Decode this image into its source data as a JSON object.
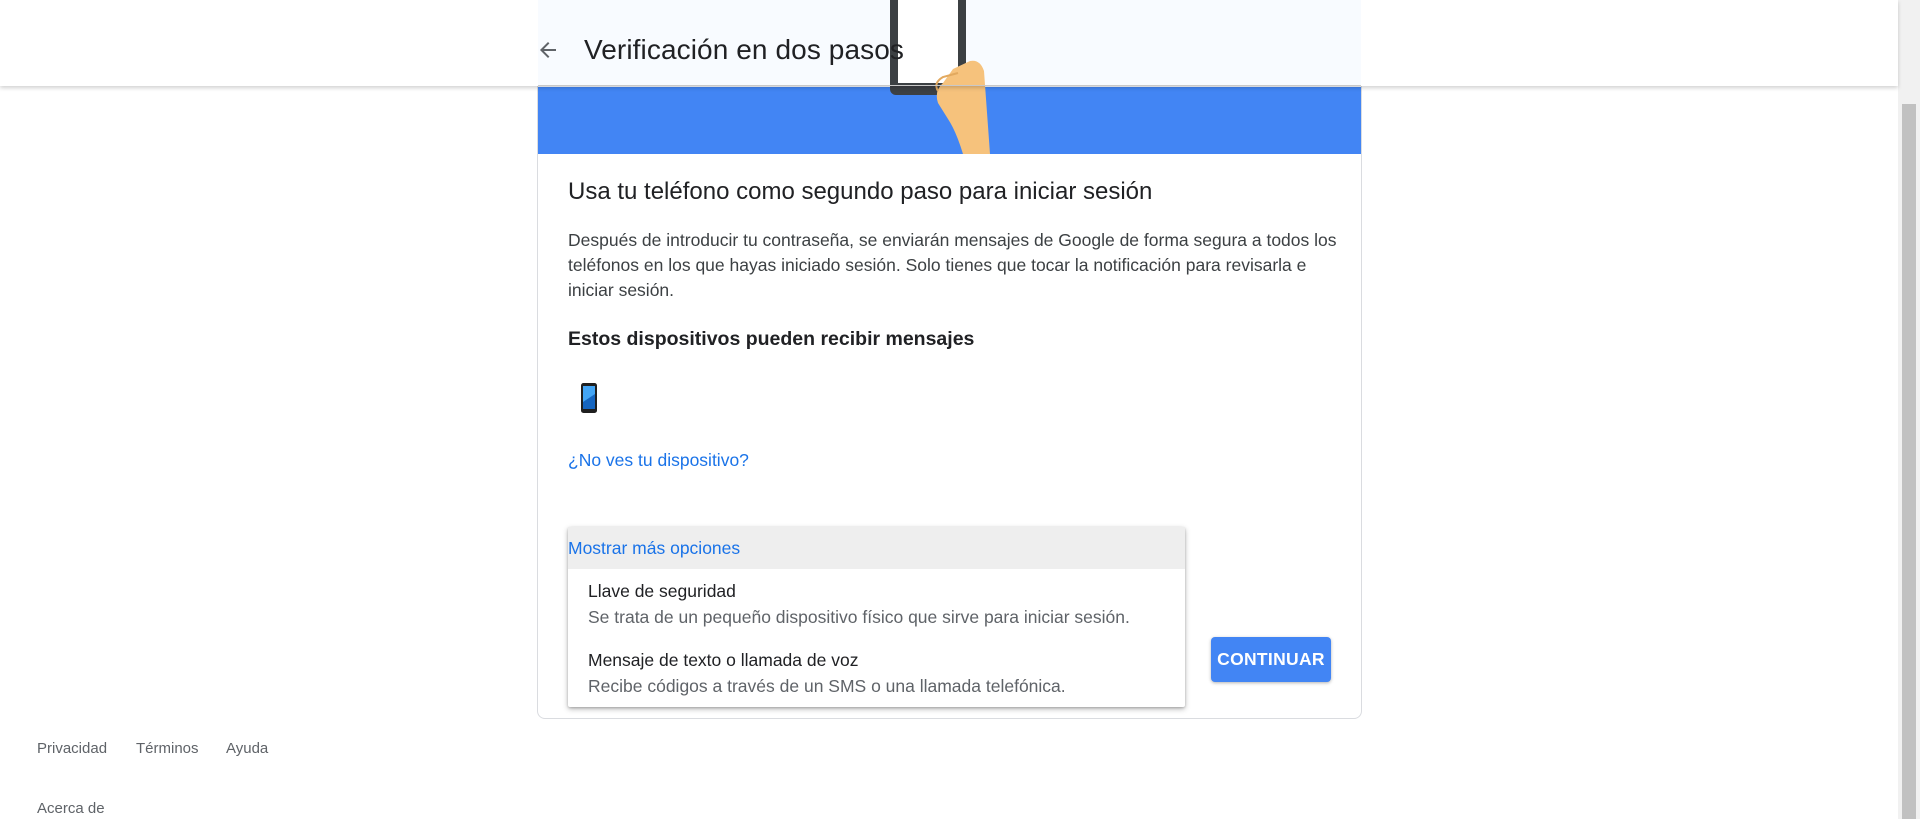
{
  "header": {
    "title": "Verificación en dos pasos",
    "back_icon": "arrow-left-icon"
  },
  "main": {
    "heading": "Usa tu teléfono como segundo paso para iniciar sesión",
    "description": "Después de introducir tu contraseña, se enviarán mensajes de Google de forma segura a todos los teléfonos en los que hayas iniciado sesión. Solo tienes que tocar la notificación para revisarla e iniciar sesión.",
    "devices_heading": "Estos dispositivos pueden recibir mensajes",
    "device_icon": "smartphone-icon",
    "no_device_link": "¿No ves tu dispositivo?"
  },
  "options_menu": {
    "header": "Mostrar más opciones",
    "items": [
      {
        "title": "Llave de seguridad",
        "subtitle": "Se trata de un pequeño dispositivo físico que sirve para iniciar sesión."
      },
      {
        "title": "Mensaje de texto o llamada de voz",
        "subtitle": "Recibe códigos a través de un SMS o una llamada telefónica."
      }
    ]
  },
  "continue_button": "CONTINUAR",
  "footer": {
    "privacy": "Privacidad",
    "terms": "Términos",
    "help": "Ayuda",
    "about": "Acerca de"
  },
  "colors": {
    "accent": "#4285f4",
    "link": "#1a73e8",
    "hero_bg": "#4285f4"
  }
}
